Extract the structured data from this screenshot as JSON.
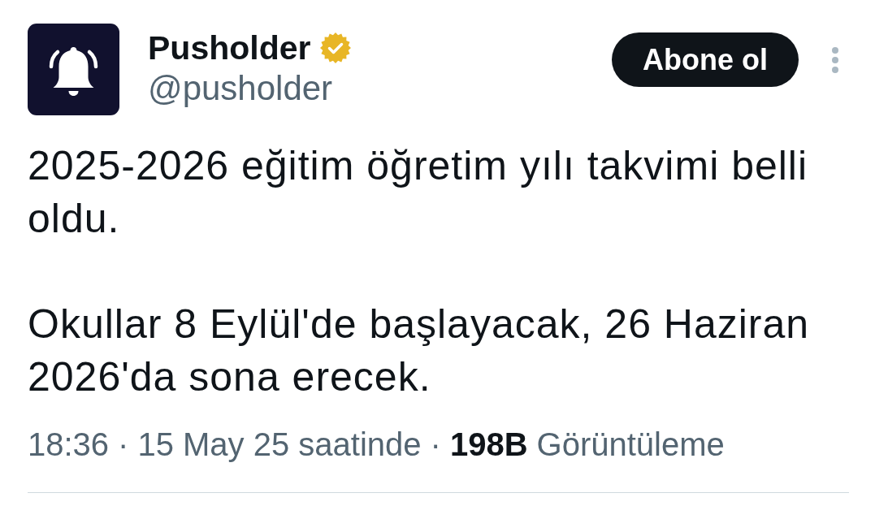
{
  "author": {
    "name": "Pusholder",
    "verified": true,
    "handle": "@pusholder"
  },
  "follow_button": {
    "label": "Abone ol"
  },
  "tweet": {
    "paragraphs": [
      "2025-2026 eğitim öğretim yılı takvimi belli oldu.",
      "Okullar 8 Eylül'de başlayacak, 26 Haziran 2026'da sona erecek."
    ]
  },
  "meta": [
    {
      "kind": "time",
      "text": "18:36"
    },
    {
      "kind": "separator",
      "text": "·"
    },
    {
      "kind": "date",
      "text": "15 May 25 saatinde"
    },
    {
      "kind": "separator",
      "text": "·"
    },
    {
      "kind": "count",
      "text": "198B"
    },
    {
      "kind": "label",
      "text": "Görüntüleme"
    }
  ]
}
